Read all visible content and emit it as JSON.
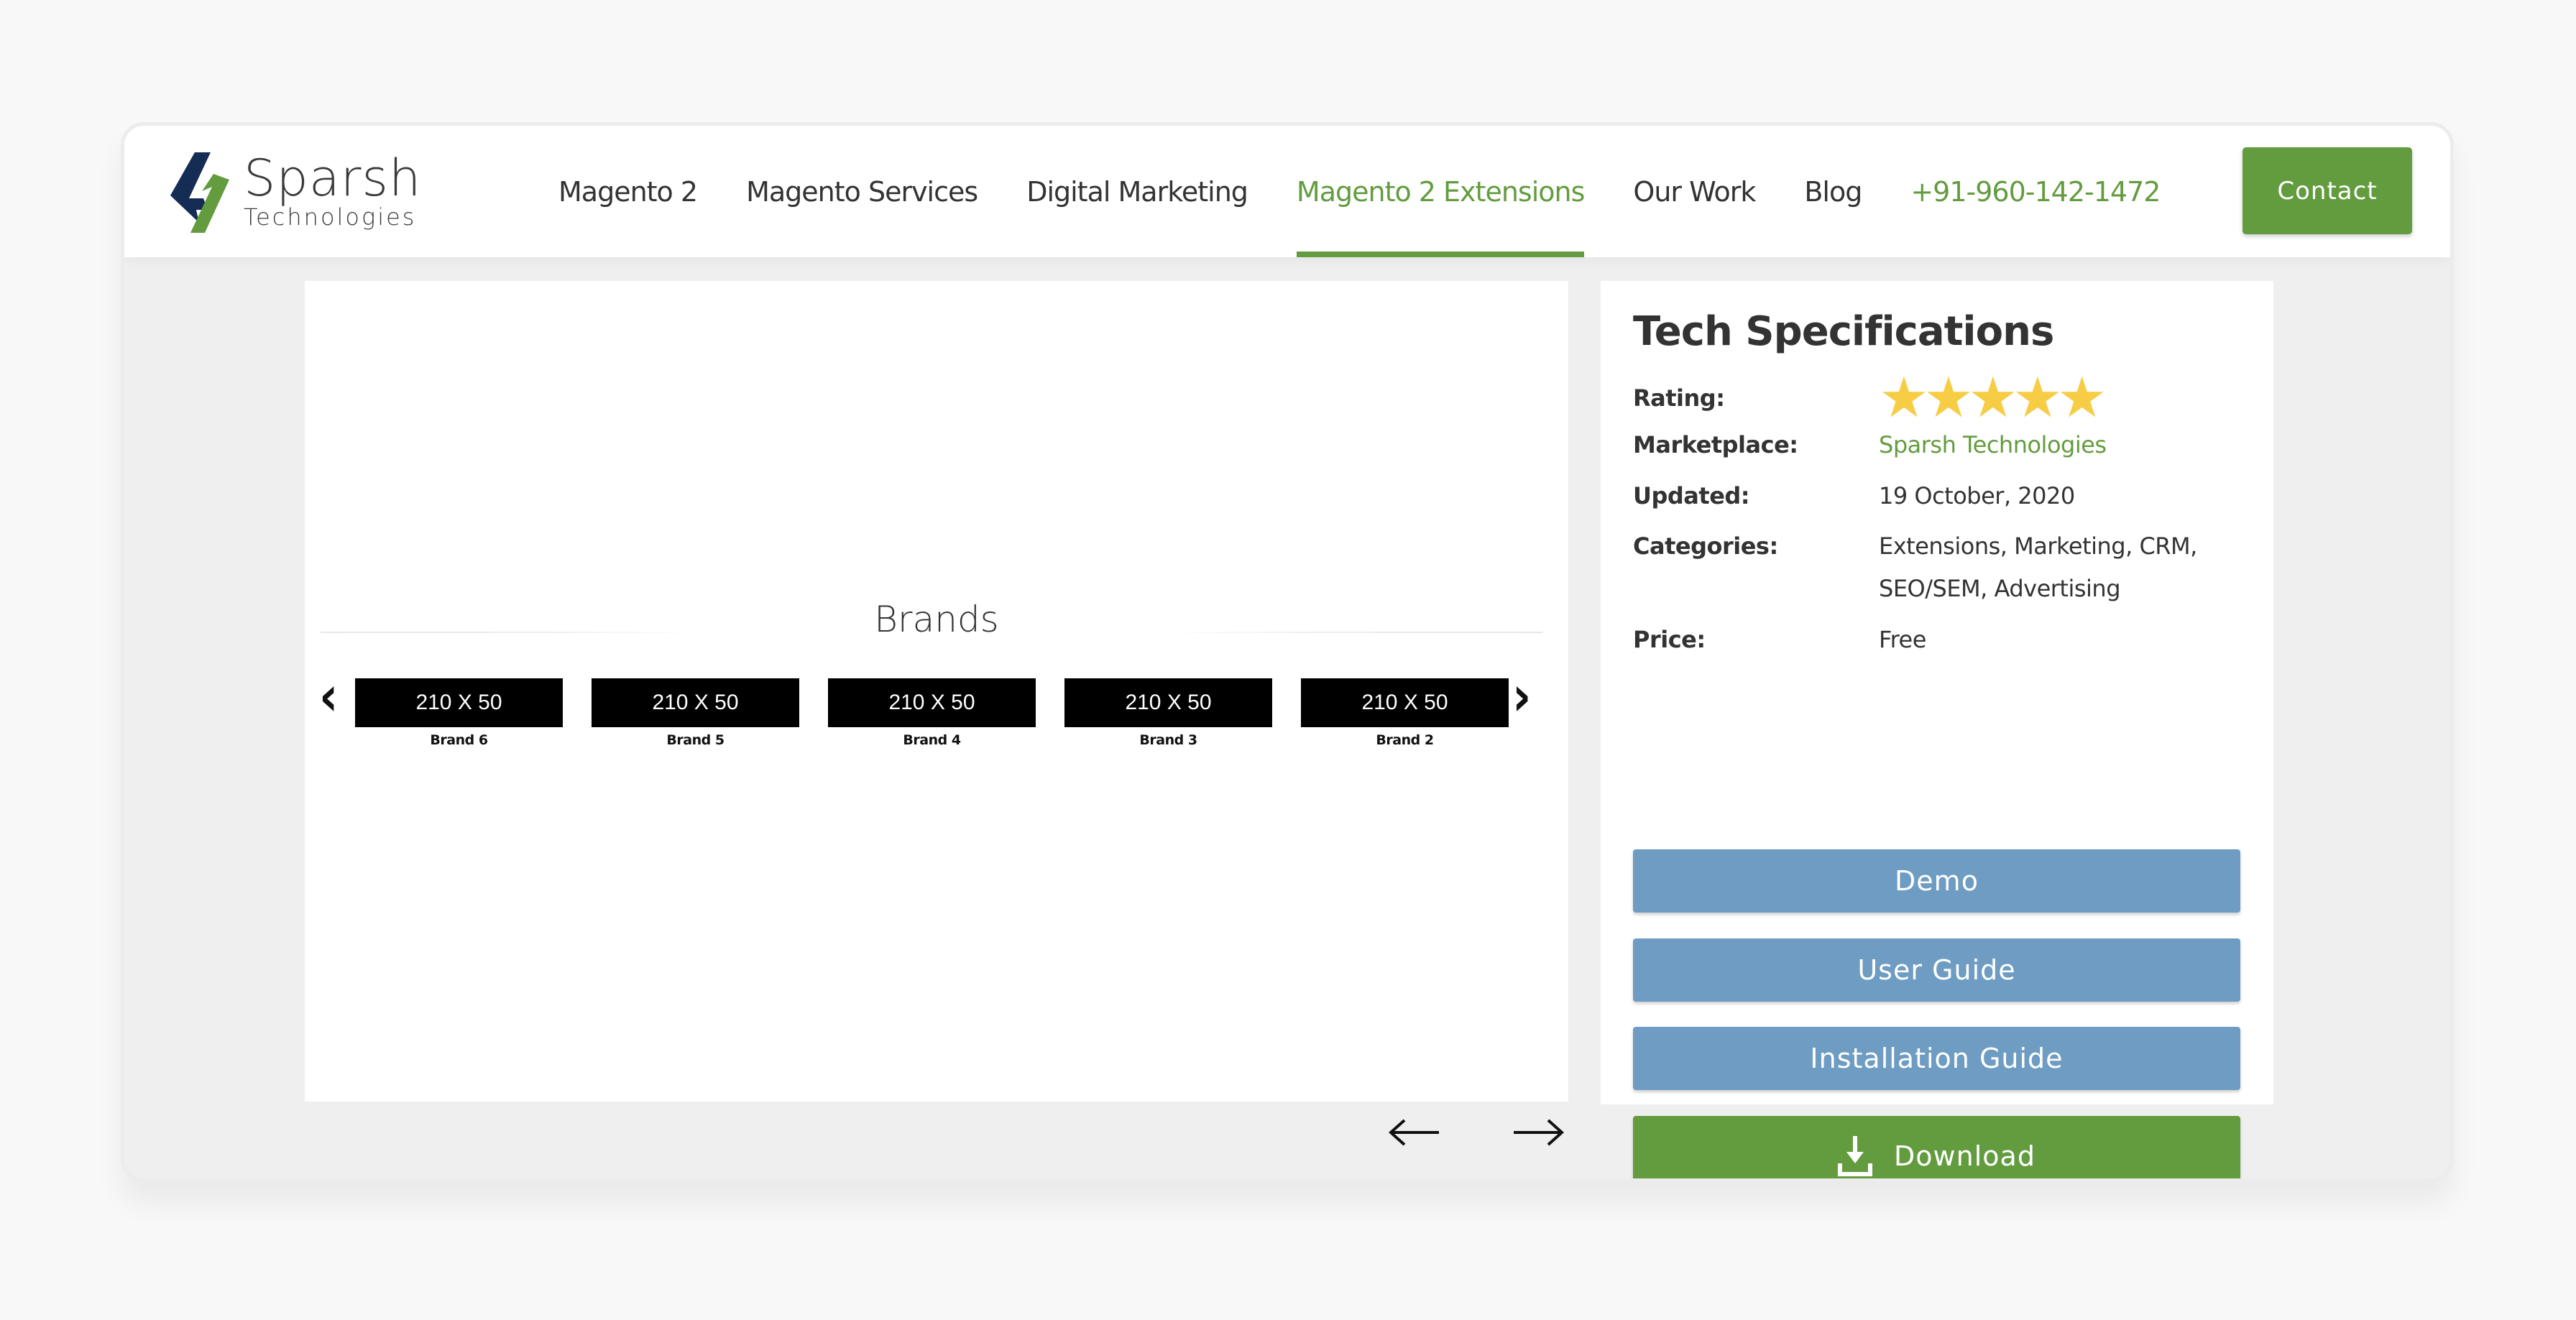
{
  "logo": {
    "name": "Sparsh",
    "sub": "Technologies",
    "colors": {
      "blue": "#152c55",
      "green": "#639c3f"
    }
  },
  "nav": {
    "items": [
      {
        "label": "Magento 2"
      },
      {
        "label": "Magento Services"
      },
      {
        "label": "Digital Marketing"
      },
      {
        "label": "Magento 2 Extensions",
        "active": true
      },
      {
        "label": "Our Work"
      },
      {
        "label": "Blog"
      }
    ],
    "phone": "+91-960-142-1472",
    "contact_label": "Contact"
  },
  "brands": {
    "title": "Brands",
    "prev_icon": "chevron-left-icon",
    "next_icon": "chevron-right-icon",
    "items": [
      {
        "box": "210 X 50",
        "label": "Brand 6"
      },
      {
        "box": "210 X 50",
        "label": "Brand 5"
      },
      {
        "box": "210 X 50",
        "label": "Brand 4"
      },
      {
        "box": "210 X 50",
        "label": "Brand 3"
      },
      {
        "box": "210 X 50",
        "label": "Brand 2"
      }
    ]
  },
  "slider": {
    "prev_icon": "arrow-left-icon",
    "next_icon": "arrow-right-icon"
  },
  "specs": {
    "title": "Tech Specifications",
    "rating_label": "Rating:",
    "rating_value": 5,
    "rating_max": 5,
    "marketplace_label": "Marketplace:",
    "marketplace_value": "Sparsh Technologies",
    "updated_label": "Updated:",
    "updated_value": "19 October, 2020",
    "categories_label": "Categories:",
    "categories_value": "Extensions, Marketing, CRM, SEO/SEM, Advertising",
    "price_label": "Price:",
    "price_value": "Free"
  },
  "buttons": {
    "demo": "Demo",
    "user_guide": "User Guide",
    "installation_guide": "Installation Guide",
    "download": "Download",
    "download_icon": "download-icon"
  },
  "colors": {
    "accent_green": "#639c3f",
    "button_blue": "#6e9cc2",
    "star_yellow": "#f7cd46"
  }
}
